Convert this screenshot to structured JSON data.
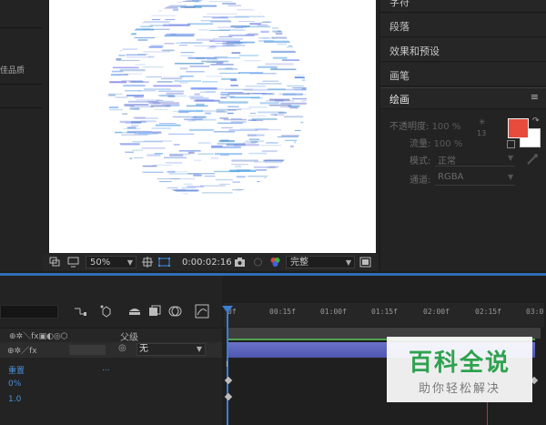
{
  "left_strip": {
    "label": "佳品质"
  },
  "viewer": {
    "zoom": "50%",
    "timecode": "0:00:02:16",
    "resolution": "完整"
  },
  "right_panels": {
    "items": [
      "字符",
      "段落",
      "效果和预设",
      "画笔"
    ],
    "paint": {
      "title": "绘画",
      "menu": "≡",
      "opacity_label": "不透明度:",
      "opacity_value": "100 %",
      "flow_label": "流量:",
      "flow_value": "100 %",
      "mode_label": "模式:",
      "mode_value": "正常",
      "channel_label": "通道:",
      "channel_value": "RGBA",
      "brush_size": "13",
      "foreground_color": "#e84a3c",
      "background_color": "#ffffff"
    }
  },
  "timeline": {
    "column_parent": "父级",
    "parent_value": "无",
    "prop_reset": "重置",
    "prop_dots": "...",
    "prop_value_1": "0%",
    "prop_value_2": "1.0",
    "ruler_ticks": [
      "0f",
      "00:15f",
      "01:00f",
      "01:15f",
      "02:00f",
      "02:15f",
      "03:0"
    ],
    "accent_color": "#2e6fb6"
  },
  "watermark": {
    "title": "百科全说",
    "subtitle": "助你轻松解决"
  }
}
